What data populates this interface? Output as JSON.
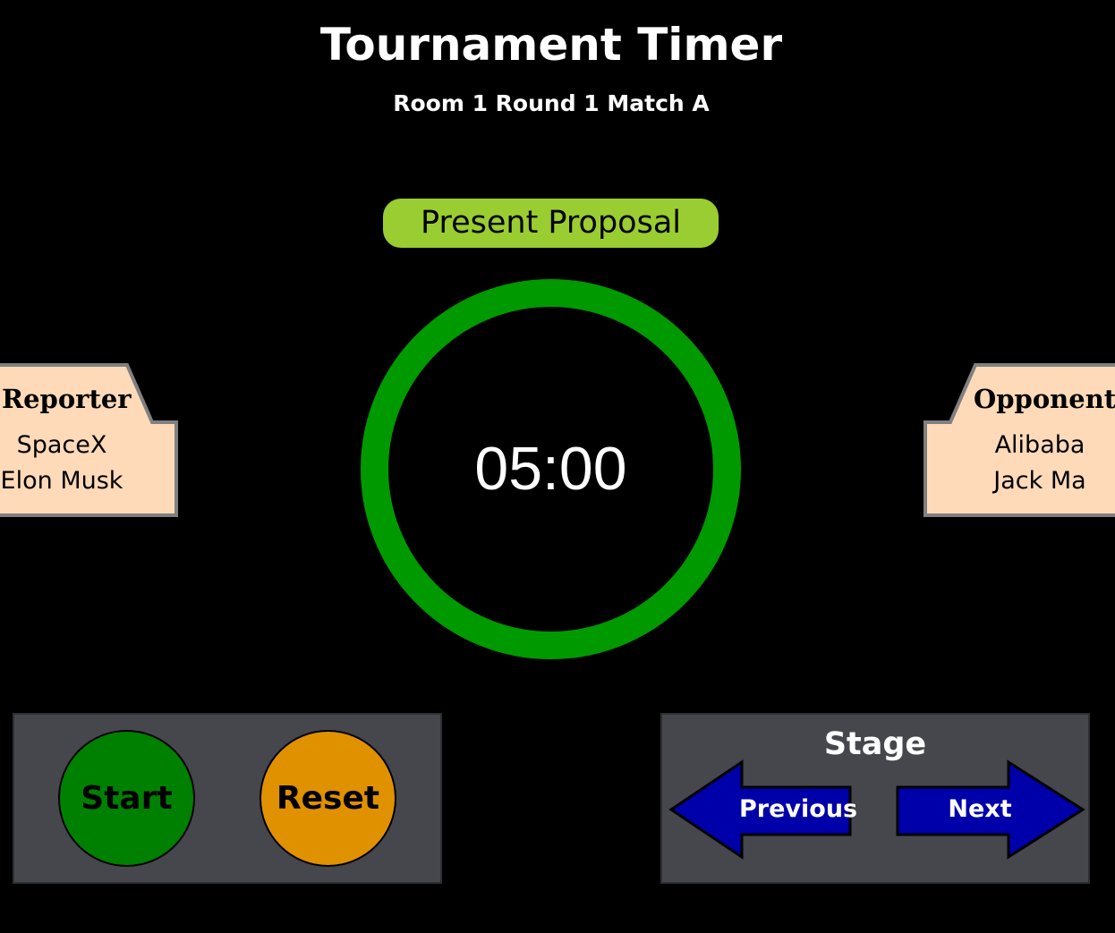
{
  "header": {
    "title": "Tournament Timer",
    "subtitle": "Room 1 Round 1 Match A"
  },
  "stage": {
    "current": "Present Proposal",
    "color": "#9acd32"
  },
  "timer": {
    "display": "05:00",
    "ring_color": "#009900",
    "progress": 1.0
  },
  "reporter": {
    "role": "Reporter",
    "team": "SpaceX",
    "person": "Elon Musk"
  },
  "opponent": {
    "role": "Opponent",
    "team": "Alibaba",
    "person": "Jack Ma"
  },
  "controls": {
    "start_label": "Start",
    "start_color": "#008000",
    "reset_label": "Reset",
    "reset_color": "#e09100"
  },
  "stage_nav": {
    "title": "Stage",
    "previous_label": "Previous",
    "next_label": "Next",
    "arrow_color": "#0000aa"
  },
  "colors": {
    "card_fill": "#ffdab9",
    "card_border": "#808080",
    "panel_bg": "#45474d"
  }
}
